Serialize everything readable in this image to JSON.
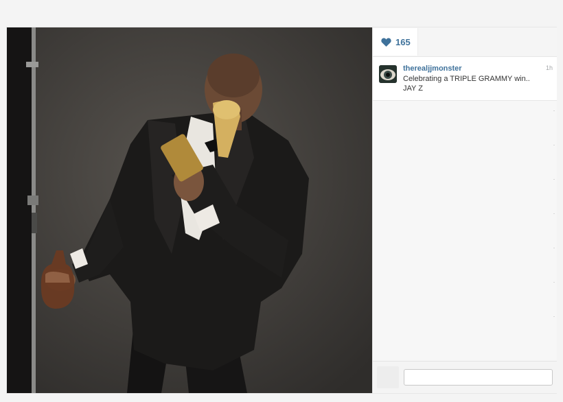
{
  "post": {
    "image": {
      "alt": "",
      "icon": "photo-image"
    },
    "likes": {
      "icon": "heart-icon",
      "count": "165"
    },
    "caption": {
      "username": "therealjjmonster",
      "text": "Celebrating a TRIPLE GRAMMY win..\nJAY Z",
      "timestamp": "1h"
    },
    "comment_input": {
      "placeholder": "",
      "value": ""
    }
  },
  "colors": {
    "accent": "#3f729b",
    "page_background": "#f4f4f4"
  }
}
